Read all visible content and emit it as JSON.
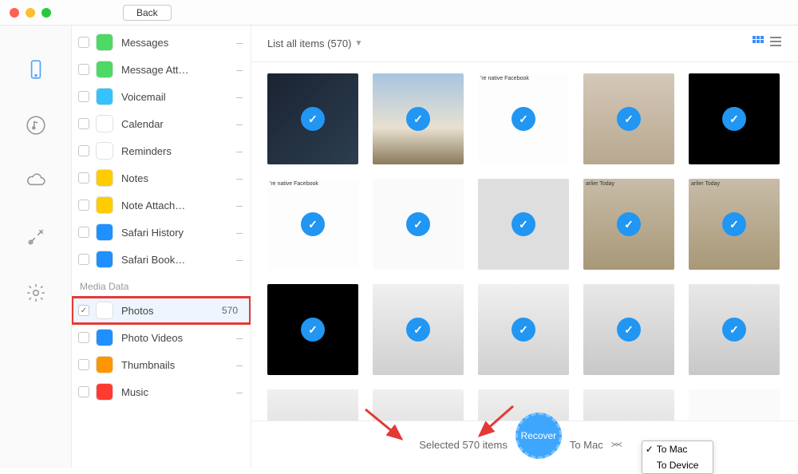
{
  "titlebar": {
    "back_label": "Back"
  },
  "rail": {
    "items": [
      {
        "name": "device-icon"
      },
      {
        "name": "music-icon"
      },
      {
        "name": "cloud-icon"
      },
      {
        "name": "tools-icon"
      },
      {
        "name": "settings-icon"
      }
    ]
  },
  "sidebar": {
    "items": [
      {
        "label": "Messages",
        "icon_bg": "#4cd964",
        "count": ""
      },
      {
        "label": "Message Att…",
        "icon_bg": "#4cd964",
        "count": ""
      },
      {
        "label": "Voicemail",
        "icon_bg": "#34c3ff",
        "count": ""
      },
      {
        "label": "Calendar",
        "icon_bg": "#ffffff",
        "count": ""
      },
      {
        "label": "Reminders",
        "icon_bg": "#ffffff",
        "count": ""
      },
      {
        "label": "Notes",
        "icon_bg": "#ffcc00",
        "count": ""
      },
      {
        "label": "Note Attach…",
        "icon_bg": "#ffcc00",
        "count": ""
      },
      {
        "label": "Safari History",
        "icon_bg": "#1e90ff",
        "count": ""
      },
      {
        "label": "Safari Book…",
        "icon_bg": "#1e90ff",
        "count": ""
      }
    ],
    "section_media": "Media Data",
    "media_items": [
      {
        "label": "Photos",
        "icon_bg": "#ffffff",
        "count": "570",
        "checked": true,
        "highlight": true
      },
      {
        "label": "Photo Videos",
        "icon_bg": "#1e90ff",
        "count": ""
      },
      {
        "label": "Thumbnails",
        "icon_bg": "#ff9500",
        "count": ""
      },
      {
        "label": "Music",
        "icon_bg": "#ff3b30",
        "count": ""
      }
    ]
  },
  "toolbar": {
    "filter_label": "List all items (570)"
  },
  "grid": {
    "rows": [
      [
        {
          "cls": "th-dark"
        },
        {
          "cls": "th-mount"
        },
        {
          "cls": "th-fb",
          "text": "'re native Facebook"
        },
        {
          "cls": "th-people"
        },
        {
          "cls": "th-black"
        }
      ],
      [
        {
          "cls": "th-fb",
          "text": "'re native Facebook"
        },
        {
          "cls": "th-list"
        },
        {
          "cls": "th-grey"
        },
        {
          "cls": "th-rec",
          "text": "arlier Today"
        },
        {
          "cls": "th-rec",
          "text": "arlier Today"
        }
      ],
      [
        {
          "cls": "th-black"
        },
        {
          "cls": "th-silver"
        },
        {
          "cls": "th-silver"
        },
        {
          "cls": "th-hub"
        },
        {
          "cls": "th-hub"
        }
      ],
      [
        {
          "cls": "th-silver"
        },
        {
          "cls": "th-silver"
        },
        {
          "cls": "th-silver"
        },
        {
          "cls": "th-silver"
        },
        {
          "cls": "th-list"
        }
      ]
    ]
  },
  "bottombar": {
    "selected_text": "Selected 570 items",
    "recover_label": "Recover",
    "to_label": "To Mac",
    "menu": [
      {
        "label": "To Mac",
        "checked": true
      },
      {
        "label": "To Device",
        "checked": false
      }
    ]
  }
}
